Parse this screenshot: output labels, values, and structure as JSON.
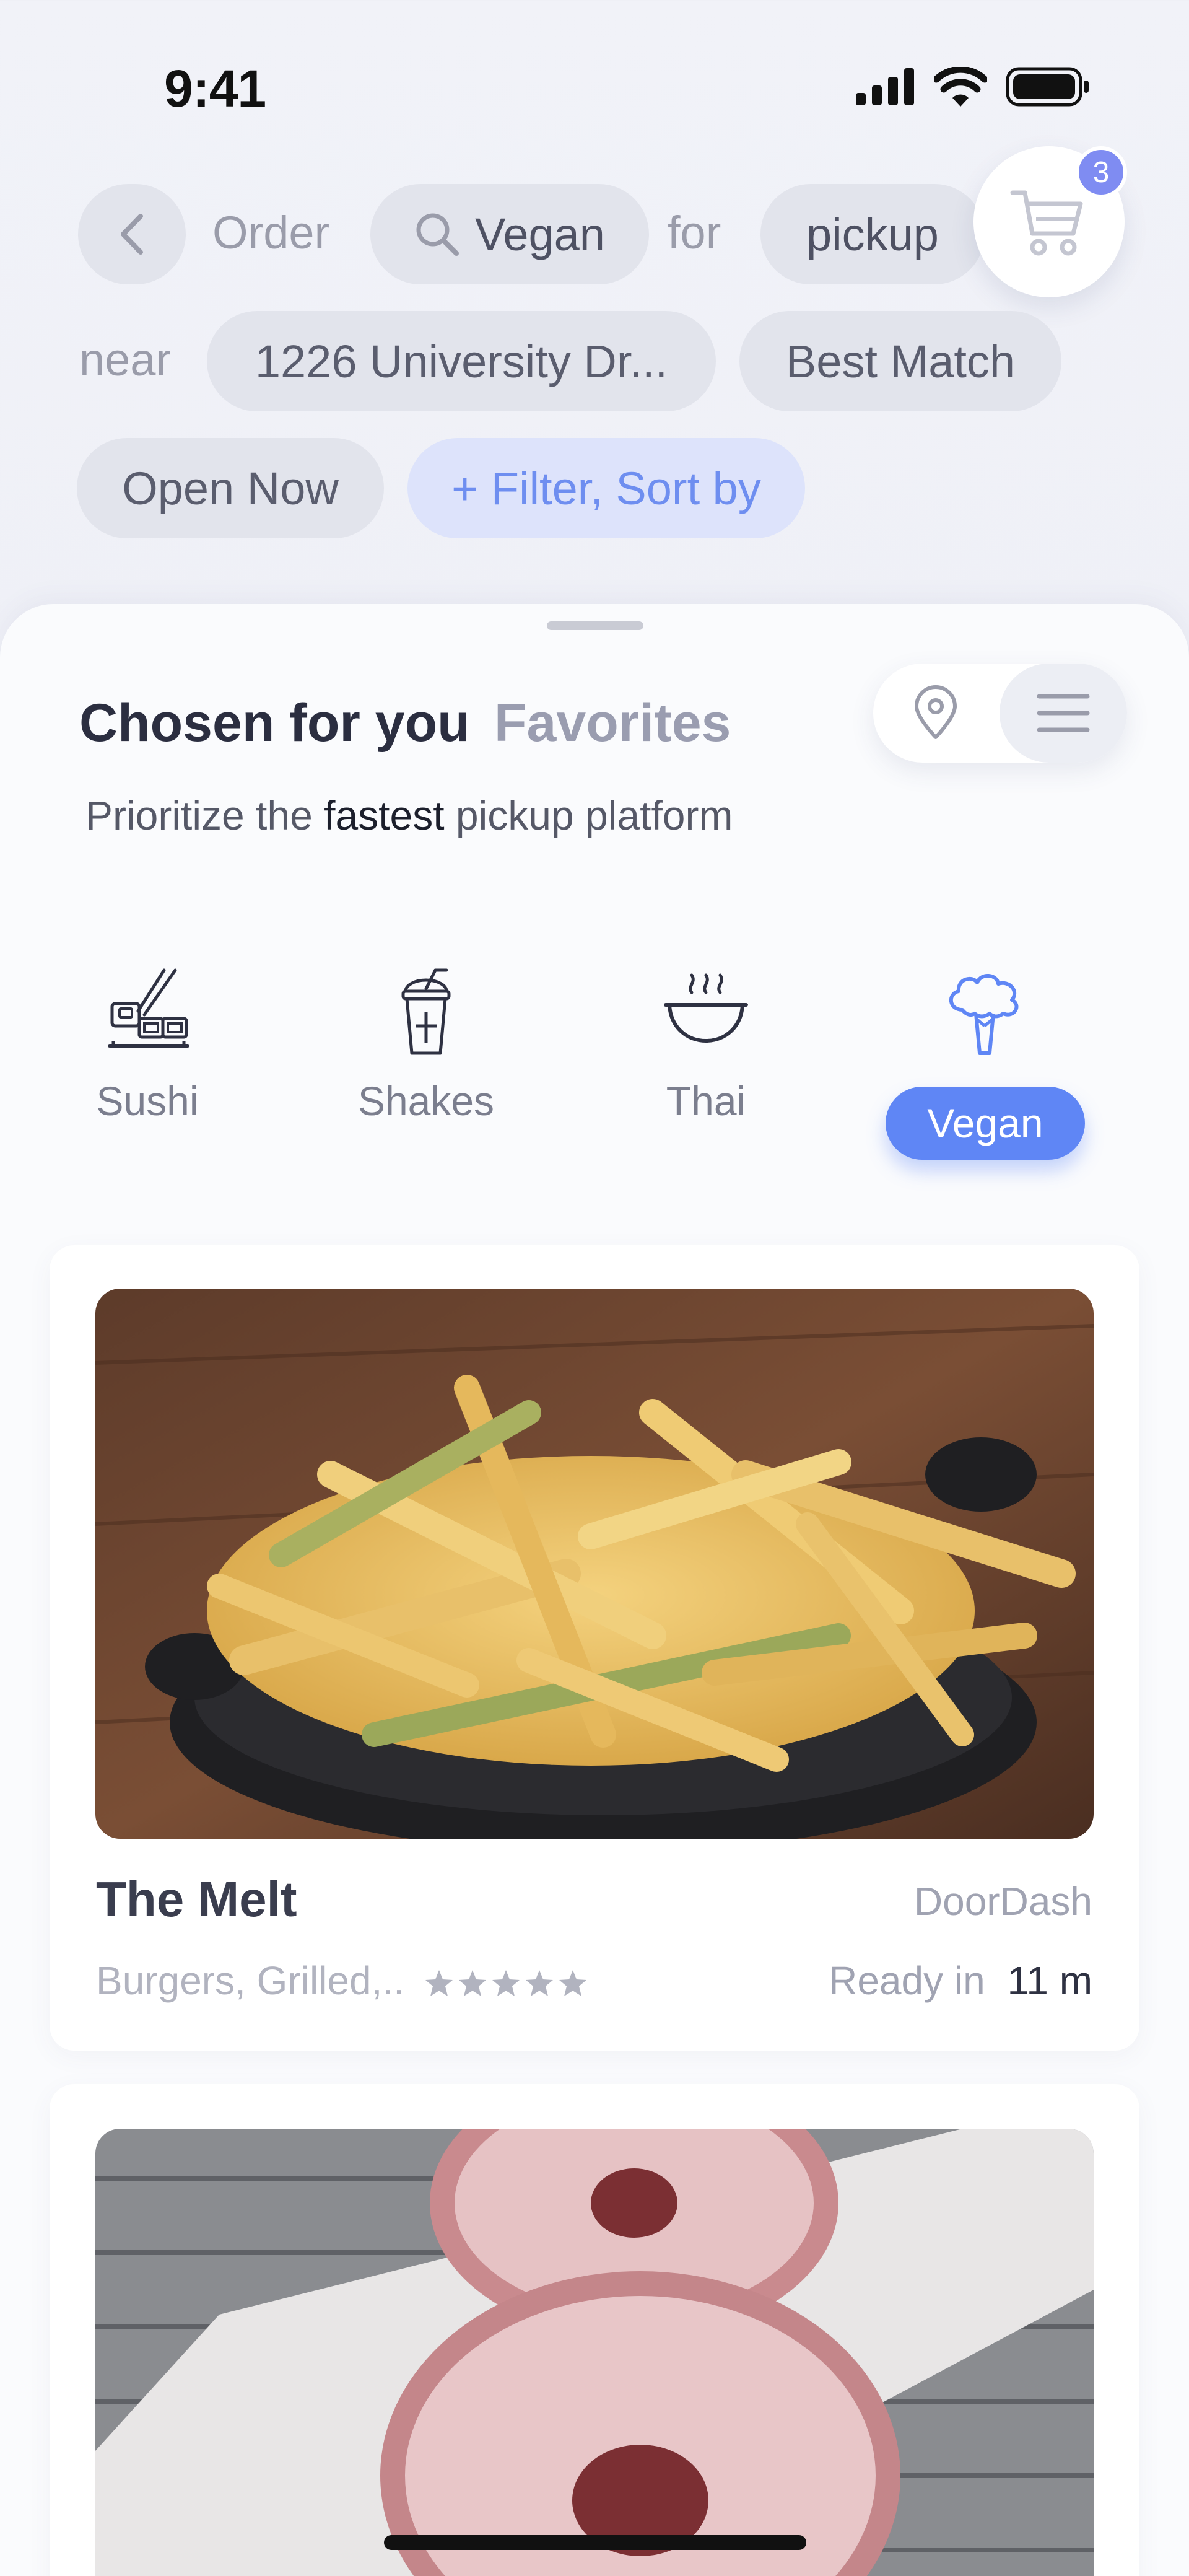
{
  "status_bar": {
    "time": "9:41"
  },
  "search": {
    "order_label": "Order",
    "query": "Vegan",
    "for_label": "for",
    "mode": "pickup",
    "near_label": "near",
    "address": "1226 University Dr...",
    "sort": "Best Match",
    "open_now": "Open Now",
    "filter_label": "+ Filter, Sort by"
  },
  "cart": {
    "count": "3"
  },
  "tabs": {
    "active": "Chosen for you",
    "inactive": "Favorites"
  },
  "subtitle": {
    "prefix": "Prioritize the ",
    "emphasis": "fastest",
    "suffix": " pickup platform"
  },
  "categories": [
    {
      "label": "Sushi",
      "icon": "sushi-icon"
    },
    {
      "label": "Shakes",
      "icon": "shake-icon"
    },
    {
      "label": "Thai",
      "icon": "thai-bowl-icon"
    },
    {
      "label": "Vegan",
      "icon": "broccoli-icon",
      "selected": true
    }
  ],
  "restaurants": [
    {
      "name": "The Melt",
      "platform": "DoorDash",
      "tags": "Burgers, Grilled,..",
      "rating": 5,
      "ready_label": "Ready in",
      "ready_time": "11 m"
    }
  ],
  "colors": {
    "accent": "#5f86f5",
    "badge": "#7f8cf2",
    "filter_pill": "#dde3fb"
  }
}
